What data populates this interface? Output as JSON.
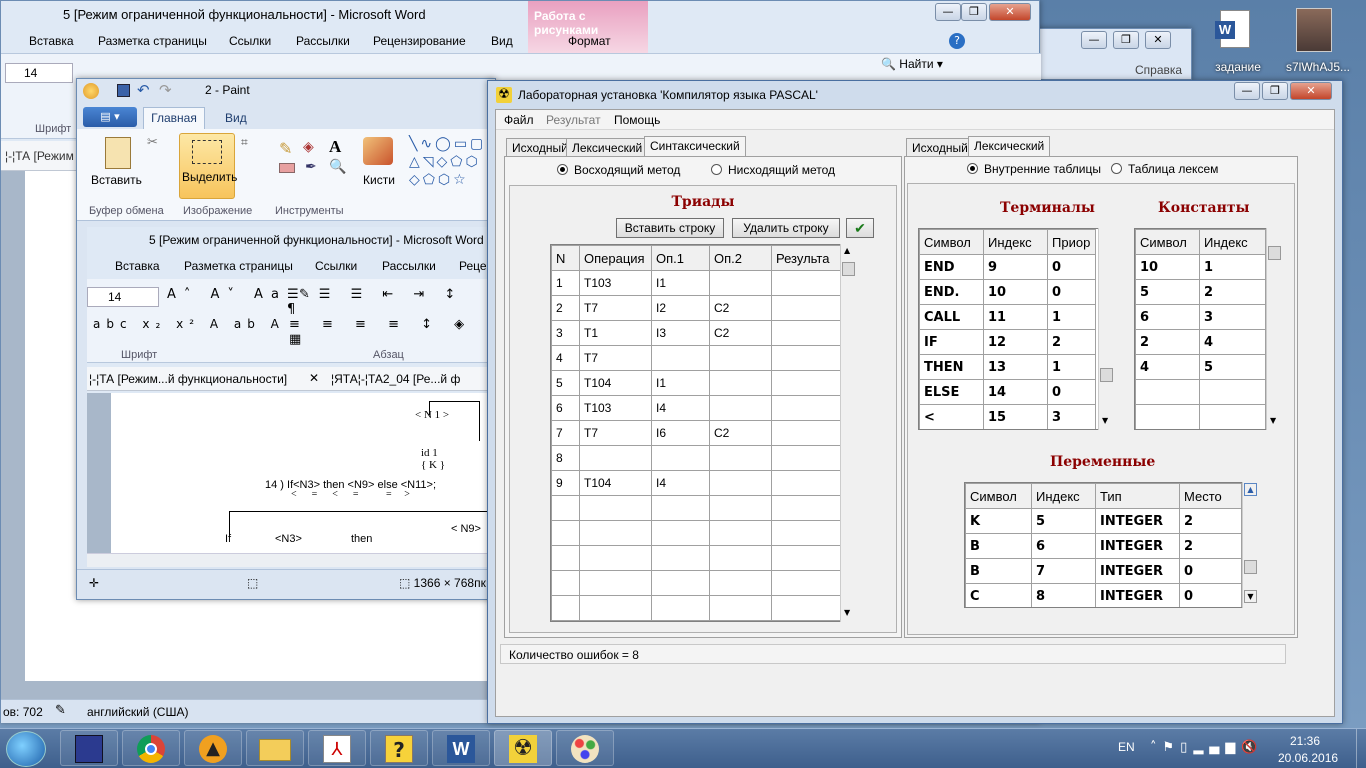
{
  "word_back": {
    "title": "5 [Режим ограниченной функциональности]  -  Microsoft Word",
    "context_tab": "Работа с рисунками",
    "context_sub": "Формат",
    "tabs": [
      "Вставка",
      "Разметка страницы",
      "Ссылки",
      "Рассылки",
      "Рецензирование",
      "Вид"
    ],
    "font_size": "14",
    "group_font": "Шрифт",
    "find_label": "Найти",
    "doc_tab": "¦-¦ТА [Режим",
    "status_left": "ов: 702",
    "status_lang": "английский (США)"
  },
  "word_back2": {
    "title": "Справка"
  },
  "paint": {
    "title": "2 - Paint",
    "tabs": [
      "Главная",
      "Вид"
    ],
    "groups": [
      "Буфер обмена",
      "Изображение",
      "Инструменты",
      "Кисти"
    ],
    "paste_label": "Вставить",
    "select_label": "Выделить",
    "brushes_label": "Кисти",
    "status_size": "1366 × 768пк"
  },
  "word_inner": {
    "title": "5 [Режим ограниченной функциональности]  -  Microsoft Word",
    "tabs": [
      "Вставка",
      "Разметка страницы",
      "Ссылки",
      "Рассылки",
      "Рецен"
    ],
    "font_size": "14",
    "group_font": "Шрифт",
    "group_para": "Абзац",
    "doc_tab1": "¦-¦ТА [Режим...й функциональности]",
    "doc_tab2": "¦ЯТА¦-¦ТА2_04 [Ре...й ф",
    "doc_lines": [
      "< N 1 >",
      "id 1",
      "{ K }",
      "14 ) If<N3>  then <N9>   else <N11>;",
      "<      =      <      =           =     >",
      "If",
      "<N3>",
      "then",
      "< N9>"
    ]
  },
  "lab": {
    "title": "Лабораторная установка 'Компилятор языка PASCAL'",
    "menu": [
      "Файл",
      "Результат",
      "Помощь"
    ],
    "left_tabs": [
      "Исходный",
      "Лексический",
      "Синтаксический"
    ],
    "right_tabs": [
      "Исходный",
      "Лексический"
    ],
    "method_up": "Восходящий метод",
    "method_down": "Нисходящий метод",
    "triads_title": "Триады",
    "btn_insert": "Вставить строку",
    "btn_delete": "Удалить строку",
    "triads_headers": [
      "N",
      "Операция",
      "Оп.1",
      "Оп.2",
      "Результа"
    ],
    "triads_rows": [
      [
        "1",
        "T103",
        "I1",
        "",
        ""
      ],
      [
        "2",
        "T7",
        "I2",
        "C2",
        ""
      ],
      [
        "3",
        "T1",
        "I3",
        "C2",
        ""
      ],
      [
        "4",
        "T7",
        "",
        "",
        ""
      ],
      [
        "5",
        "T104",
        "I1",
        "",
        ""
      ],
      [
        "6",
        "T103",
        "I4",
        "",
        ""
      ],
      [
        "7",
        "T7",
        "I6",
        "C2",
        ""
      ],
      [
        "8",
        "",
        "",
        "",
        ""
      ],
      [
        "9",
        "T104",
        "I4",
        "",
        ""
      ],
      [
        "",
        "",
        "",
        "",
        ""
      ],
      [
        "",
        "",
        "",
        "",
        ""
      ],
      [
        "",
        "",
        "",
        "",
        ""
      ],
      [
        "",
        "",
        "",
        "",
        ""
      ],
      [
        "",
        "",
        "",
        "",
        ""
      ]
    ],
    "opt_internal": "Внутренние таблицы",
    "opt_lexemes": "Таблица лексем",
    "terminals_title": "Терминалы",
    "terminals_headers": [
      "Символ",
      "Индекс",
      "Приор"
    ],
    "terminals_rows": [
      [
        "END",
        "9",
        "0"
      ],
      [
        "END.",
        "10",
        "0"
      ],
      [
        "CALL",
        "11",
        "1"
      ],
      [
        "IF",
        "12",
        "2"
      ],
      [
        "THEN",
        "13",
        "1"
      ],
      [
        "ELSE",
        "14",
        "0"
      ],
      [
        "<",
        "15",
        "3"
      ]
    ],
    "constants_title": "Константы",
    "constants_headers": [
      "Символ",
      "Индекс"
    ],
    "constants_rows": [
      [
        "10",
        "1"
      ],
      [
        "5",
        "2"
      ],
      [
        "6",
        "3"
      ],
      [
        "2",
        "4"
      ],
      [
        "4",
        "5"
      ],
      [
        "",
        ""
      ],
      [
        "",
        ""
      ]
    ],
    "vars_title": "Переменные",
    "vars_headers": [
      "Символ",
      "Индекс",
      "Тип",
      "Место"
    ],
    "vars_rows": [
      [
        "K",
        "5",
        "INTEGER",
        "2"
      ],
      [
        "B",
        "6",
        "INTEGER",
        "2"
      ],
      [
        "B",
        "7",
        "INTEGER",
        "0"
      ],
      [
        "C",
        "8",
        "INTEGER",
        "0"
      ]
    ],
    "status": "Количество ошибок = 8"
  },
  "desktop": {
    "icon1": "задание",
    "icon2": "s7lWhAJ5..."
  },
  "taskbar": {
    "lang": "EN",
    "time": "21:36",
    "date": "20.06.2016"
  },
  "colors": {
    "title_red": "#8b0000",
    "context_pink": "#e04f8a",
    "ribbon_blue": "#dbe6f4"
  }
}
